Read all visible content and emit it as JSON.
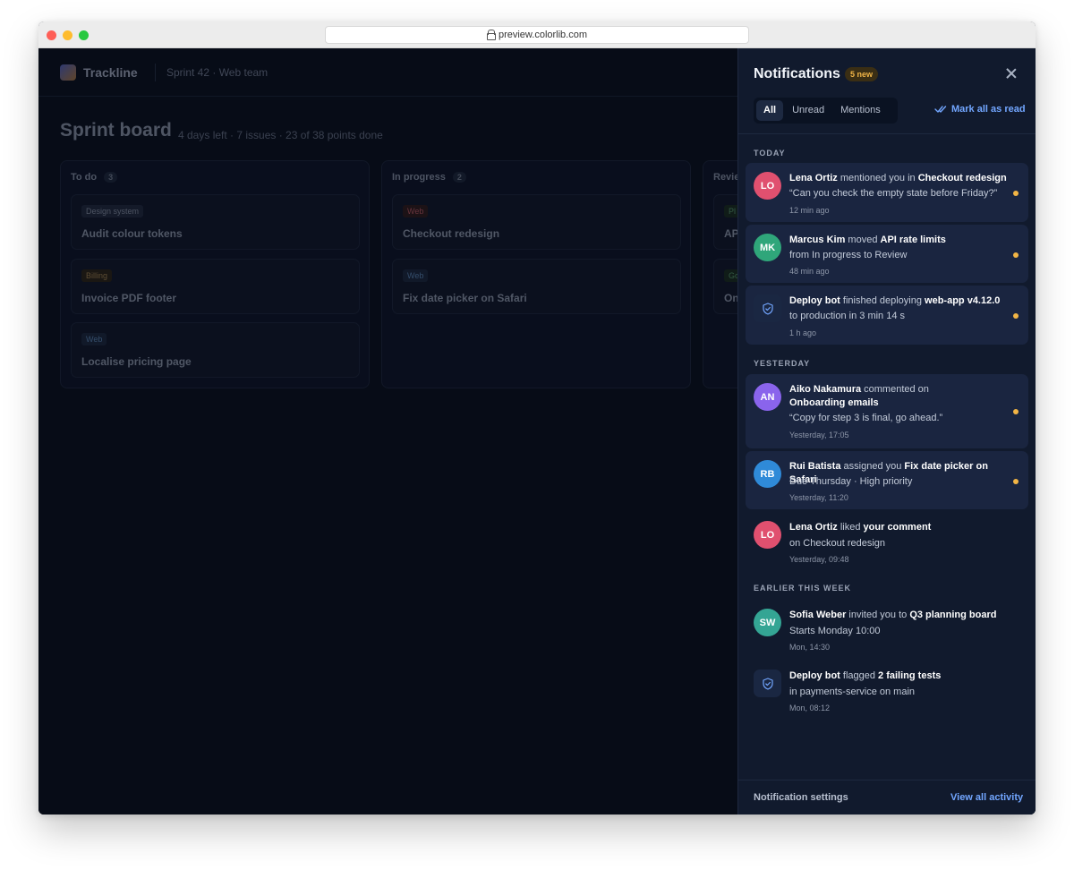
{
  "browser": {
    "url": "preview.colorlib.com"
  },
  "app": {
    "name": "Trackline",
    "breadcrumb": "Sprint 42 · Web team"
  },
  "board": {
    "title": "Sprint board",
    "meta": "4 days left · 7 issues · 23 of 38 points done",
    "columns": [
      {
        "name": "To do",
        "count": "3",
        "cards": [
          {
            "tag": "Design system",
            "title": "Audit colour tokens"
          },
          {
            "tag": "Billing",
            "title": "Invoice PDF footer"
          },
          {
            "tag": "Web",
            "title": "Localise pricing page"
          }
        ]
      },
      {
        "name": "In progress",
        "count": "2",
        "cards": [
          {
            "tag": "Web",
            "title": "Checkout redesign"
          },
          {
            "tag": "Web",
            "title": "Fix date picker on Safari"
          }
        ]
      },
      {
        "name": "Revie",
        "count": "",
        "cards": [
          {
            "tag": "Pl",
            "title": "AP"
          },
          {
            "tag": "Go",
            "title": "On"
          }
        ]
      }
    ]
  },
  "notifications": {
    "title": "Notifications",
    "badge": "5 new",
    "tabs": [
      "All",
      "Unread",
      "Mentions"
    ],
    "mark_all": "Mark all as read",
    "sections": {
      "today": "TODAY",
      "yesterday": "YESTERDAY",
      "earlier": "EARLIER THIS WEEK"
    },
    "items": [
      {
        "initials": "LO",
        "color": "#e0506f",
        "actor": "Lena Ortiz",
        "verb": " mentioned you in ",
        "target": "Checkout redesign",
        "line2": "“Can you check the empty state before Friday?”",
        "time": "12 min ago",
        "unread": true
      },
      {
        "initials": "MK",
        "color": "#2fa67a",
        "actor": "Marcus Kim",
        "verb": " moved ",
        "target": "API rate limits",
        "line2": "from In progress to Review",
        "time": "48 min ago",
        "unread": true
      },
      {
        "initials": "",
        "icon": "shield-check-icon",
        "actor": "Deploy bot",
        "verb": " finished deploying ",
        "target": "web-app v4.12.0",
        "line2": "to production in 3 min 14 s",
        "time": "1 h ago",
        "unread": true
      },
      {
        "initials": "AN",
        "color": "#8a64ec",
        "actor": "Aiko Nakamura",
        "verb": " commented on ",
        "target": "Onboarding emails",
        "line2": "“Copy for step 3 is final, go ahead.”",
        "time": "Yesterday, 17:05",
        "unread": true
      },
      {
        "initials": "RB",
        "color": "#2f8ad8",
        "actor": "Rui Batista",
        "verb": " assigned you ",
        "target": "Fix date picker on Safari",
        "line2": "Due Thursday · High priority",
        "time": "Yesterday, 11:20",
        "unread": true
      },
      {
        "initials": "LO",
        "color": "#e0506f",
        "actor": "Lena Ortiz",
        "verb": " liked ",
        "target": "your comment",
        "line2": "on Checkout redesign",
        "time": "Yesterday, 09:48",
        "unread": false
      },
      {
        "initials": "SW",
        "color": "#34a594",
        "actor": "Sofia Weber",
        "verb": " invited you to ",
        "target": "Q3 planning board",
        "line2": "Starts Monday 10:00",
        "time": "Mon, 14:30",
        "unread": false
      },
      {
        "initials": "",
        "icon": "shield-check-icon",
        "actor": "Deploy bot",
        "verb": " flagged ",
        "target": "2 failing tests",
        "line2": "in payments-service on main",
        "time": "Mon, 08:12",
        "unread": false
      }
    ],
    "footer": {
      "settings": "Notification settings",
      "view_all": "View all activity"
    },
    "accent": "#72a6ff",
    "unread_dot": "#f2b545"
  }
}
